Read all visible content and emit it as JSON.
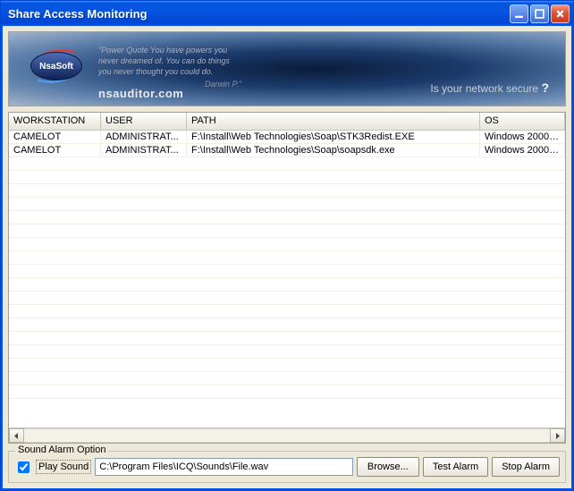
{
  "window": {
    "title": "Share Access Monitoring"
  },
  "banner": {
    "logo_text": "NsaSoft",
    "quote": "\"Power Quote You have powers you never dreamed of. You can do things you never thought you could do.",
    "quote_author": "Darwin P.\"",
    "url": "nsauditor.com",
    "tagline": "Is your network secure",
    "tagline_mark": "?"
  },
  "columns": {
    "workstation": "WORKSTATION",
    "user": "USER",
    "path": "PATH",
    "os": "OS"
  },
  "rows": [
    {
      "workstation": "CAMELOT",
      "user": "ADMINISTRAT...",
      "path": "F:\\Install\\Web Technologies\\Soap\\STK3Redist.EXE",
      "os": "Windows 2000 ..."
    },
    {
      "workstation": "CAMELOT",
      "user": "ADMINISTRAT...",
      "path": "F:\\Install\\Web Technologies\\Soap\\soapsdk.exe",
      "os": "Windows 2000 ..."
    }
  ],
  "alarm": {
    "legend": "Sound Alarm Option",
    "play_label": "Play Sound",
    "path": "C:\\Program Files\\ICQ\\Sounds\\File.wav",
    "browse": "Browse...",
    "test": "Test Alarm",
    "stop": "Stop Alarm"
  }
}
